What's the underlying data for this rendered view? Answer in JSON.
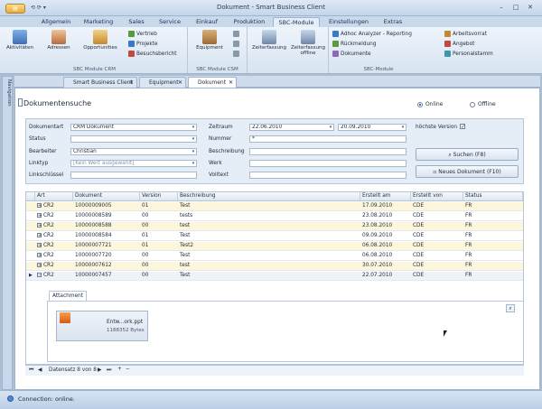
{
  "window": {
    "title": "Dokument - Smart Business Client",
    "app_button": "▤",
    "quick_access": "⟲ ⟳ ▾"
  },
  "ribbon_tabs": [
    "Allgemein",
    "Marketing",
    "Sales",
    "Service",
    "Einkauf",
    "Produktion",
    "SBC-Module",
    "Einstellungen",
    "Extras"
  ],
  "ribbon": {
    "crm": {
      "group": "SBC Module CRM",
      "big": [
        "Aktivitäten",
        "Adressen",
        "Opportunities"
      ],
      "small": [
        "Vertrieb",
        "Projekte",
        "Besuchsbericht"
      ]
    },
    "csm": {
      "group": "SBC Module CSM",
      "big": [
        "Equipment"
      ]
    },
    "misc": {
      "big": [
        "Zeiterfassung",
        "Zeiterfassung offline"
      ]
    },
    "reports": {
      "group": "SBC-Module",
      "small": [
        "Adhoc Analyzer - Reporting",
        "Rückmeldung",
        "Dokumente"
      ],
      "small2": [
        "Arbeitsvorrat",
        "Angebot",
        "Personalstamm"
      ]
    }
  },
  "nav_label": "Navigation",
  "doc_tabs": [
    "Smart Business Client",
    "Equipment",
    "Dokument"
  ],
  "page_title": "Dokumentensuche",
  "mode": {
    "online": "Online",
    "offline": "Offline"
  },
  "form": {
    "dokumentart_label": "Dokumentart",
    "dokumentart": "CRM Dokument",
    "status_label": "Status",
    "status": "",
    "bearbeiter_label": "Bearbeiter",
    "bearbeiter": "Christian",
    "linktyp_label": "Linktyp",
    "linktyp_placeholder": "[Kein Wert ausgewählt]",
    "linkschluessel_label": "Linkschlüssel",
    "linkschluessel": "",
    "zeitraum_label": "Zeitraum",
    "von": "22.06.2010",
    "bis": "20.09.2010",
    "nummer_label": "Nummer",
    "nummer": "*",
    "beschreibung_label": "Beschreibung",
    "beschreibung": "",
    "werk_label": "Werk",
    "werk": "",
    "volltext_label": "Volltext",
    "volltext": "",
    "hoechste_label": "höchste Version",
    "hoechste_check": "✓",
    "suchen": "Suchen (F8)",
    "neues": "Neues Dokument (F10)"
  },
  "grid": {
    "headers": [
      "Art",
      "Dokument",
      "Version",
      "Beschreibung",
      "Erstellt am",
      "Erstellt von",
      "Status"
    ],
    "rows": [
      [
        "CR2",
        "10000009005",
        "01",
        "Test",
        "17.09.2010",
        "CDE",
        "FR"
      ],
      [
        "CR2",
        "10000008589",
        "00",
        "tests",
        "23.08.2010",
        "CDE",
        "FR"
      ],
      [
        "CR2",
        "10000008588",
        "00",
        "test",
        "23.08.2010",
        "CDE",
        "FR"
      ],
      [
        "CR2",
        "10000008584",
        "01",
        "Test",
        "09.09.2010",
        "CDE",
        "FR"
      ],
      [
        "CR2",
        "10000007721",
        "01",
        "Test2",
        "06.08.2010",
        "CDE",
        "FR"
      ],
      [
        "CR2",
        "10000007720",
        "00",
        "Test",
        "06.08.2010",
        "CDE",
        "FR"
      ],
      [
        "CR2",
        "10000007612",
        "00",
        "test",
        "30.07.2010",
        "CDE",
        "FR"
      ],
      [
        "CR2",
        "10000007457",
        "00",
        "Test",
        "22.07.2010",
        "CDE",
        "FR"
      ]
    ]
  },
  "attachment": {
    "tab": "Attachment",
    "file": "Entw...ork.ppt",
    "size": "1188352 Bytes"
  },
  "navigator": {
    "record": "Datensatz 8 von 8"
  },
  "status": "Connection: online."
}
